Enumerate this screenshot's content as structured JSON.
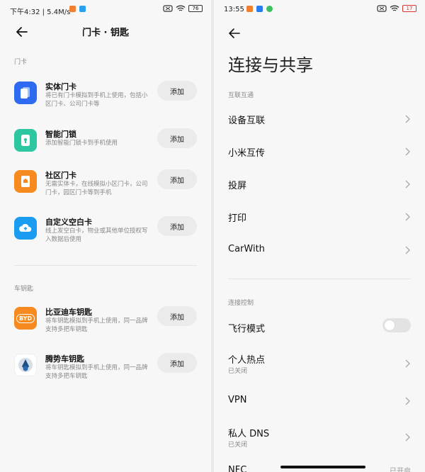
{
  "left": {
    "status": {
      "time": "下午4:32 | 5.4M/s",
      "battery": "76"
    },
    "title": "门卡 · 钥匙",
    "section_door": "门卡",
    "section_car": "车钥匙",
    "add_label": "添加",
    "items": [
      {
        "title": "实体门卡",
        "desc": "将已有门卡模拟到手机上使用，包括小区门卡、公司门卡等",
        "icon": "card-icon",
        "color": "#2f6bf0"
      },
      {
        "title": "智能门锁",
        "desc": "添加智能门锁卡到手机使用",
        "icon": "lock-icon",
        "color": "#2cc7a0"
      },
      {
        "title": "社区门卡",
        "desc": "无需实体卡，在线模拟小区门卡，公司门卡，园区门卡等到手机",
        "icon": "community-card-icon",
        "color": "#f68a1e"
      },
      {
        "title": "自定义空白卡",
        "desc": "线上发空白卡，物业或其他单位授权写入数据后使用",
        "icon": "cloud-card-icon",
        "color": "#1a9cf0"
      }
    ],
    "car_items": [
      {
        "title": "比亚迪车钥匙",
        "desc": "将车钥匙模拟到手机上使用，同一品牌支持多把车钥匙",
        "icon": "byd-logo-icon",
        "color": "#f68a1e",
        "logo_text": "BYD"
      },
      {
        "title": "腾势车钥匙",
        "desc": "将车钥匙模拟到手机上使用，同一品牌支持多把车钥匙",
        "icon": "denza-logo-icon",
        "color": "#ffffff"
      }
    ]
  },
  "right": {
    "status": {
      "time": "13:55",
      "battery": "17"
    },
    "title": "连接与共享",
    "section_interconnect": "互联互通",
    "section_control": "连接控制",
    "rows": [
      {
        "title": "设备互联"
      },
      {
        "title": "小米互传"
      },
      {
        "title": "投屏"
      },
      {
        "title": "打印"
      },
      {
        "title": "CarWith"
      }
    ],
    "control_rows": [
      {
        "title": "飞行模式"
      },
      {
        "title": "个人热点",
        "sub": "已关闭"
      },
      {
        "title": "VPN"
      },
      {
        "title": "私人 DNS",
        "sub": "已关闭"
      }
    ],
    "cut_row": {
      "title": "NFC",
      "trail": "已开启"
    }
  }
}
